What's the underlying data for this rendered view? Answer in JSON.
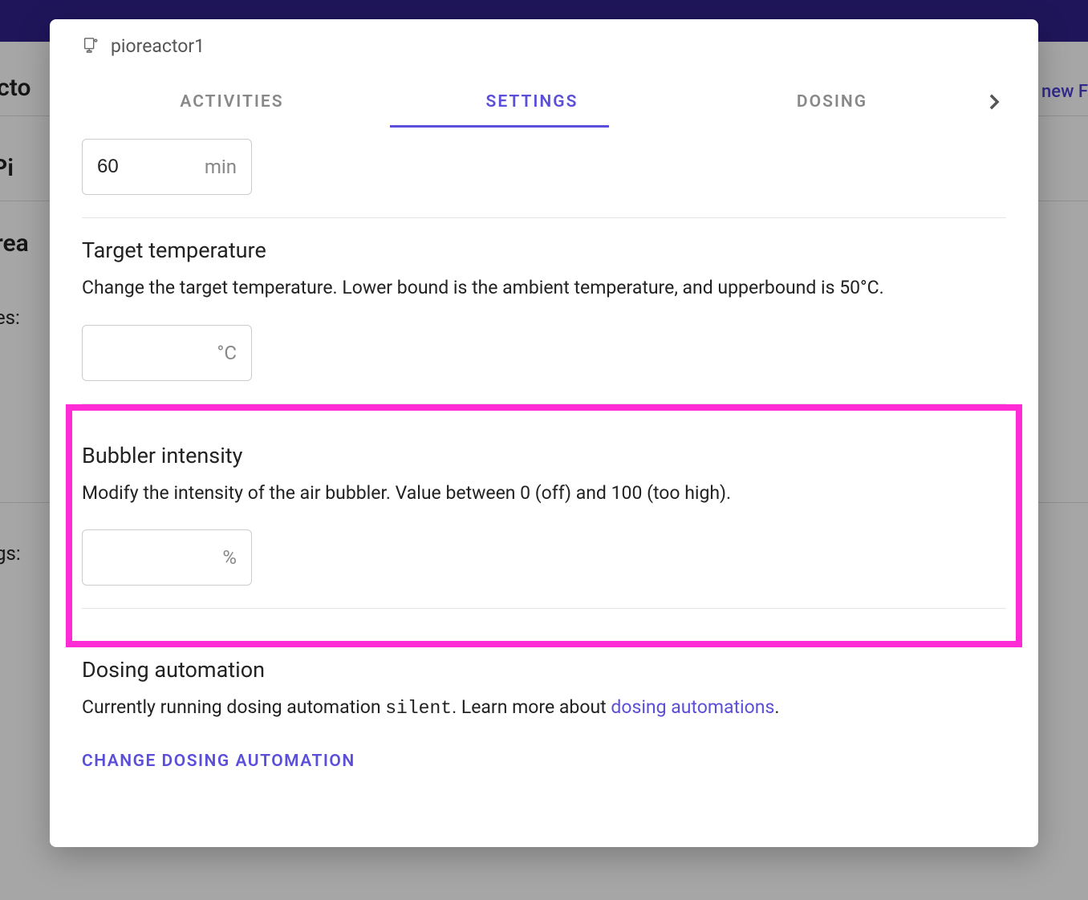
{
  "background": {
    "text_left_1": "acto",
    "text_left_2": "Pi",
    "text_left_3": "orea",
    "text_left_4": "ies:",
    "text_left_5": "gs:",
    "text_right_1": "d new F"
  },
  "device": {
    "name": "pioreactor1"
  },
  "tabs": [
    {
      "label": "ACTIVITIES",
      "active": false
    },
    {
      "label": "SETTINGS",
      "active": true
    },
    {
      "label": "DOSING",
      "active": false
    }
  ],
  "first_input": {
    "value": "60",
    "unit": "min"
  },
  "sections": {
    "target_temp": {
      "title": "Target temperature",
      "desc": "Change the target temperature. Lower bound is the ambient temperature, and upperbound is 50°C.",
      "value": "",
      "unit": "°C"
    },
    "bubbler": {
      "title": "Bubbler intensity",
      "desc": "Modify the intensity of the air bubbler. Value between 0 (off) and 100 (too high).",
      "value": "",
      "unit": "%"
    },
    "dosing": {
      "title": "Dosing automation",
      "desc_prefix": "Currently running dosing automation ",
      "automation_name": "silent",
      "desc_mid": ". Learn more about ",
      "link_text": "dosing automations",
      "desc_suffix": ".",
      "change_button": "CHANGE DOSING AUTOMATION"
    }
  }
}
